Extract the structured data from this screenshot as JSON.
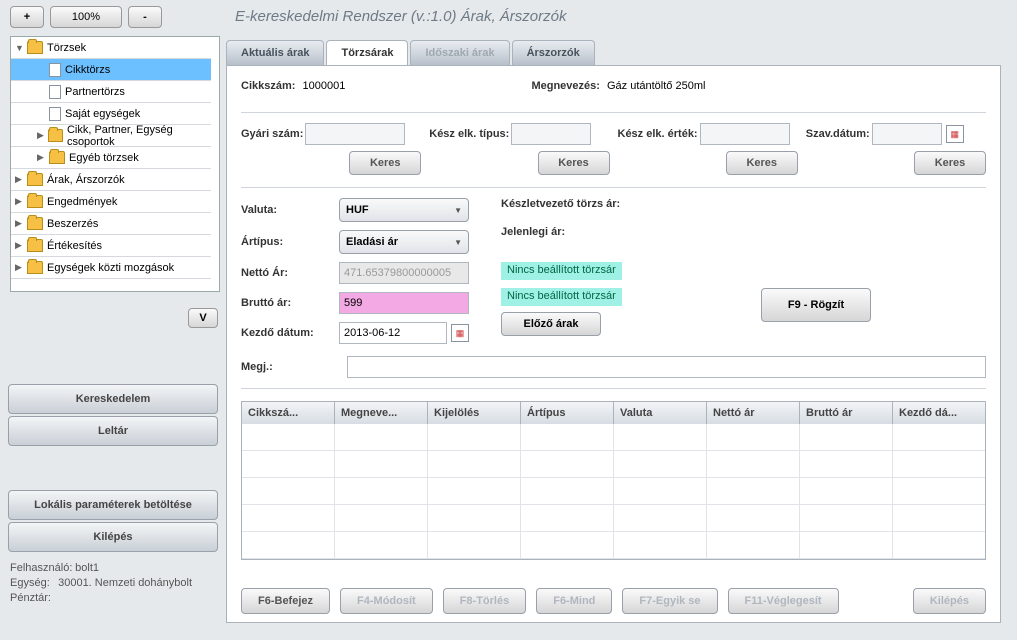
{
  "zoom": {
    "minus": "-",
    "pct": "100%",
    "plus": "+"
  },
  "title": "E-kereskedelmi Rendszer (v.:1.0)   Árak, Árszorzók",
  "tree": {
    "items": [
      {
        "label": "Törzsek",
        "kind": "folder",
        "indent": 0,
        "open": true
      },
      {
        "label": "Cikktörzs",
        "kind": "file",
        "indent": 1,
        "selected": true
      },
      {
        "label": "Partnertörzs",
        "kind": "file",
        "indent": 1
      },
      {
        "label": "Saját egységek",
        "kind": "file",
        "indent": 1
      },
      {
        "label": "Cikk, Partner, Egység csoportok",
        "kind": "folder",
        "indent": 1,
        "closed": true
      },
      {
        "label": "Egyéb törzsek",
        "kind": "folder",
        "indent": 1,
        "closed": true
      },
      {
        "label": "Árak, Árszorzók",
        "kind": "folder",
        "indent": 0,
        "closed": true
      },
      {
        "label": "Engedmények",
        "kind": "folder",
        "indent": 0,
        "closed": true
      },
      {
        "label": "Beszerzés",
        "kind": "folder",
        "indent": 0,
        "closed": true
      },
      {
        "label": "Értékesítés",
        "kind": "folder",
        "indent": 0,
        "closed": true
      },
      {
        "label": "Egységek közti mozgások",
        "kind": "folder",
        "indent": 0,
        "closed": true
      }
    ]
  },
  "v_btn": "V",
  "side_buttons": {
    "commerce": "Kereskedelem",
    "inventory": "Leltár",
    "load_params": "Lokális paraméterek betöltése",
    "exit": "Kilépés"
  },
  "status": {
    "user_lbl": "Felhasználó:",
    "user": "bolt1",
    "unit_lbl": "Egység:",
    "unit": "30001. Nemzeti dohánybolt",
    "cash_lbl": "Pénztár:"
  },
  "tabs": {
    "t0": "Aktuális árak",
    "t1": "Törzsárak",
    "t2": "Időszaki árak",
    "t3": "Árszorzók"
  },
  "header": {
    "sku_lbl": "Cikkszám:",
    "sku": "1000001",
    "name_lbl": "Megnevezés:",
    "name": "Gáz utántöltő 250ml"
  },
  "search": {
    "f1": "Gyári szám:",
    "f2": "Kész elk. típus:",
    "f3": "Kész elk. érték:",
    "f4": "Szav.dátum:",
    "keres": "Keres"
  },
  "form": {
    "valuta_lbl": "Valuta:",
    "valuta": "HUF",
    "artipus_lbl": "Ártípus:",
    "artipus": "Eladási ár",
    "netto_lbl": "Nettó Ár:",
    "netto": "471.65379800000005",
    "brutto_lbl": "Bruttó ár:",
    "brutto": "599",
    "kezdo_lbl": "Kezdő dátum:",
    "kezdo": "2013-06-12",
    "megj_lbl": "Megj.:",
    "keszlet_lbl": "Készletvezető törzs ár:",
    "jelenlegi_lbl": "Jelenlegi ár:",
    "msg1": "Nincs beállított törzsár",
    "msg2": "Nincs beállított törzsár",
    "prev": "Előző árak",
    "record": "F9 - Rögzít"
  },
  "grid": {
    "cols": [
      "Cikkszá...",
      "Megneve...",
      "Kijelölés",
      "Ártípus",
      "Valuta",
      "Nettó ár",
      "Bruttó ár",
      "Kezdő dá..."
    ]
  },
  "bottom": {
    "b0": "F6-Befejez",
    "b1": "F4-Módosít",
    "b2": "F8-Törlés",
    "b3": "F6-Mind",
    "b4": "F7-Egyik se",
    "b5": "F11-Véglegesít",
    "b6": "Kilépés"
  }
}
